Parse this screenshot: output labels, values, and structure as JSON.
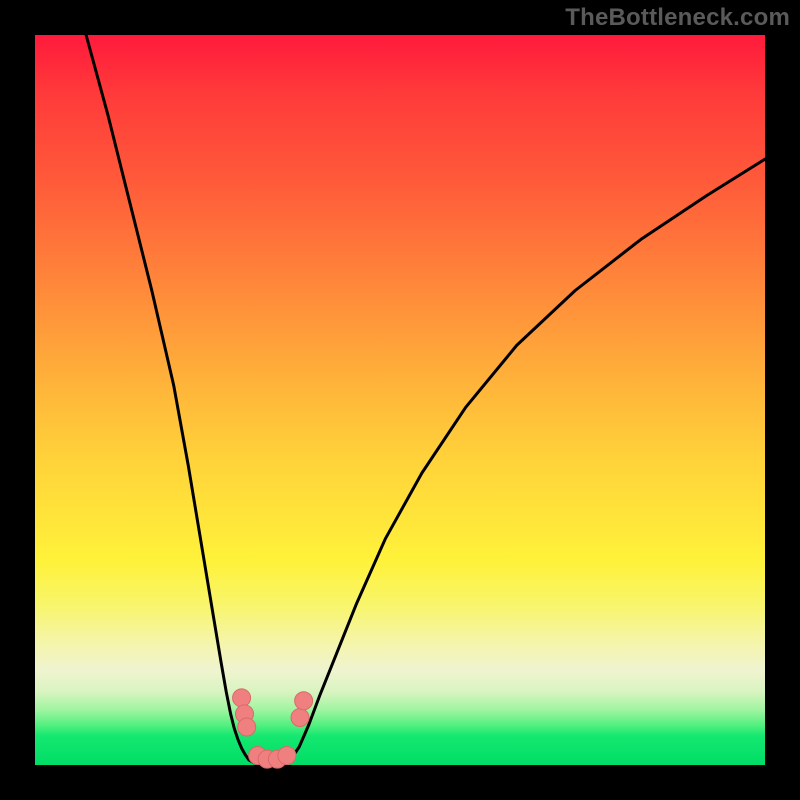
{
  "watermark": "TheBottleneck.com",
  "colors": {
    "frame": "#000000",
    "curve": "#000000",
    "marker_fill": "#f08080",
    "marker_stroke": "#d86a6a"
  },
  "chart_data": {
    "type": "line",
    "title": "",
    "xlabel": "",
    "ylabel": "",
    "xlim": [
      0,
      100
    ],
    "ylim": [
      0,
      100
    ],
    "grid": false,
    "series": [
      {
        "name": "left-branch",
        "x": [
          7,
          10,
          13,
          16,
          19,
          21,
          23,
          24.5,
          25.5,
          26.2,
          26.8,
          27.3,
          27.8,
          28.3,
          28.8,
          29.3
        ],
        "y": [
          100,
          89,
          77,
          65,
          52,
          41,
          29,
          20,
          14,
          10,
          7,
          5,
          3.5,
          2.3,
          1.4,
          0.7
        ]
      },
      {
        "name": "valley-floor",
        "x": [
          29.3,
          30.0,
          31.0,
          32.0,
          33.0,
          34.0,
          35.0
        ],
        "y": [
          0.7,
          0.3,
          0.1,
          0.05,
          0.1,
          0.3,
          0.7
        ]
      },
      {
        "name": "right-branch",
        "x": [
          35.0,
          36.2,
          37.5,
          39,
          41,
          44,
          48,
          53,
          59,
          66,
          74,
          83,
          92,
          100
        ],
        "y": [
          0.7,
          2.5,
          5.5,
          9.5,
          14.5,
          22,
          31,
          40,
          49,
          57.5,
          65,
          72,
          78,
          83
        ]
      }
    ],
    "markers": [
      {
        "name": "left-cluster-upper-1",
        "x": 28.3,
        "y": 9.2
      },
      {
        "name": "left-cluster-upper-2",
        "x": 28.7,
        "y": 7.0
      },
      {
        "name": "left-cluster-upper-3",
        "x": 29.0,
        "y": 5.2
      },
      {
        "name": "floor-1",
        "x": 30.5,
        "y": 1.3
      },
      {
        "name": "floor-2",
        "x": 31.8,
        "y": 0.8
      },
      {
        "name": "floor-3",
        "x": 33.2,
        "y": 0.8
      },
      {
        "name": "floor-4",
        "x": 34.5,
        "y": 1.3
      },
      {
        "name": "right-cluster-1",
        "x": 36.3,
        "y": 6.5
      },
      {
        "name": "right-cluster-2",
        "x": 36.8,
        "y": 8.8
      }
    ]
  }
}
